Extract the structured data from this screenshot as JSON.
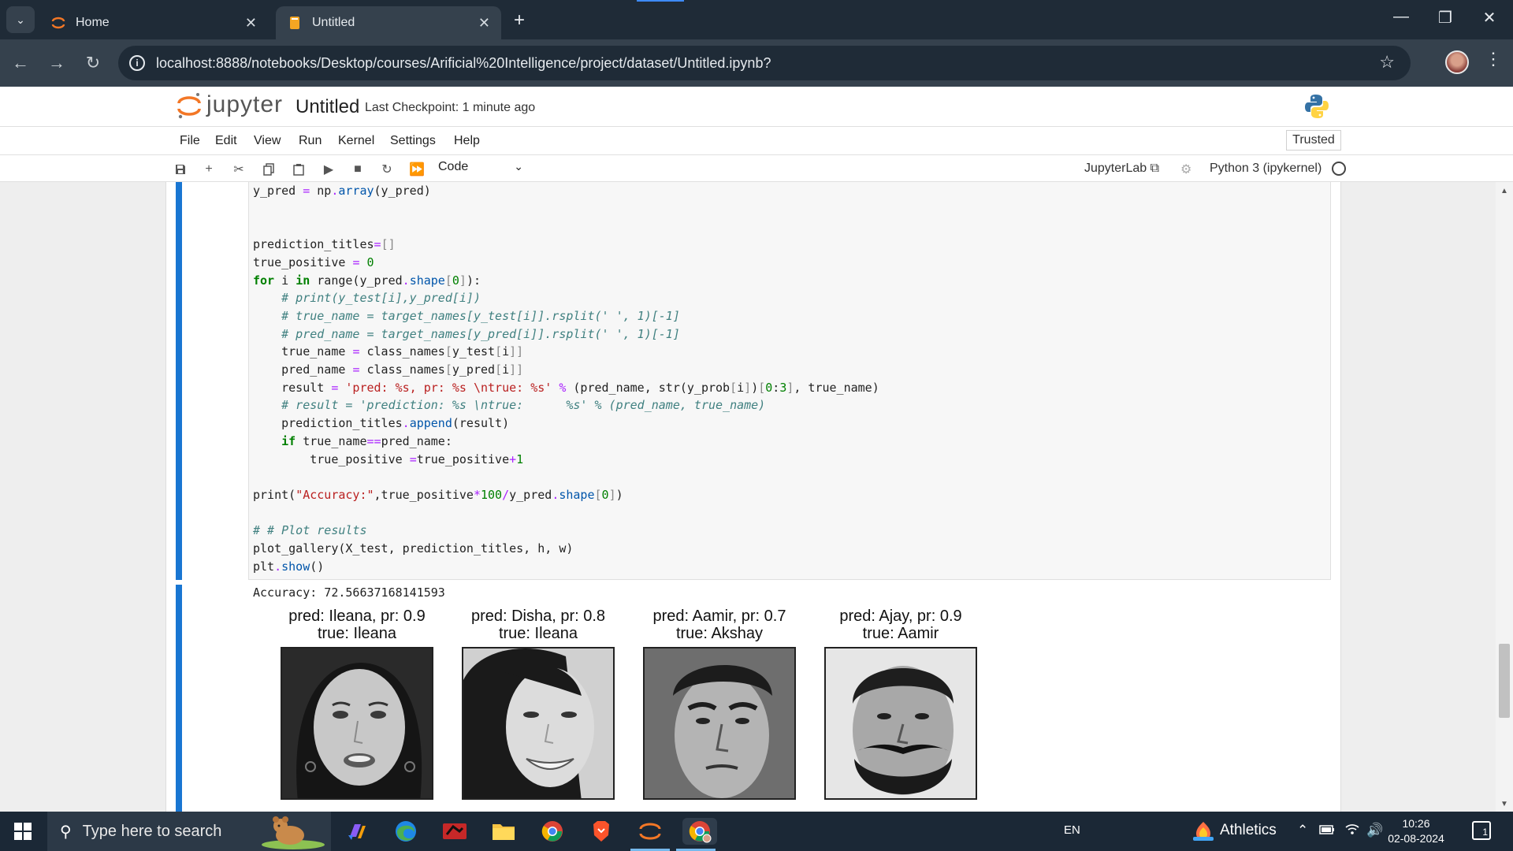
{
  "browser": {
    "tabs": [
      {
        "title": "Home",
        "active": false
      },
      {
        "title": "Untitled",
        "active": true
      }
    ],
    "url": "localhost:8888/notebooks/Desktop/courses/Arificial%20Intelligence/project/dataset/Untitled.ipynb?"
  },
  "jupyter": {
    "wordmark": "jupyter",
    "notebook_title": "Untitled",
    "checkpoint": "Last Checkpoint: 1 minute ago",
    "menu": [
      "File",
      "Edit",
      "View",
      "Run",
      "Kernel",
      "Settings",
      "Help"
    ],
    "trusted": "Trusted",
    "toolbar": {
      "cell_type": "Code",
      "jupyterlab_link": "JupyterLab",
      "kernel": "Python 3 (ipykernel)"
    }
  },
  "cell": {
    "code_lines": [
      "y_pred = np.array(y_pred)",
      "",
      "",
      "prediction_titles=[]",
      "true_positive = 0",
      "for i in range(y_pred.shape[0]):",
      "    # print(y_test[i],y_pred[i])",
      "    # true_name = target_names[y_test[i]].rsplit(' ', 1)[-1]",
      "    # pred_name = target_names[y_pred[i]].rsplit(' ', 1)[-1]",
      "    true_name = class_names[y_test[i]]",
      "    pred_name = class_names[y_pred[i]]",
      "    result = 'pred: %s, pr: %s \\ntrue: %s' % (pred_name, str(y_prob[i])[0:3], true_name)",
      "    # result = 'prediction: %s \\ntrue:      %s' % (pred_name, true_name)",
      "    prediction_titles.append(result)",
      "    if true_name==pred_name:",
      "        true_positive =true_positive+1",
      "",
      "print(\"Accuracy:\",true_positive*100/y_pred.shape[0])",
      "",
      "# # Plot results",
      "plot_gallery(X_test, prediction_titles, h, w)",
      "plt.show()"
    ],
    "output_text": "Accuracy: 72.56637168141593",
    "gallery": [
      {
        "line1": "pred: Ileana, pr: 0.9",
        "line2": "true: Ileana"
      },
      {
        "line1": "pred: Disha, pr: 0.8",
        "line2": "true: Ileana"
      },
      {
        "line1": "pred: Aamir, pr: 0.7",
        "line2": "true: Akshay"
      },
      {
        "line1": "pred: Ajay, pr: 0.9",
        "line2": "true: Aamir"
      }
    ]
  },
  "taskbar": {
    "search_placeholder": "Type here to search",
    "language": "EN",
    "weather": "Athletics",
    "time": "10:26",
    "date": "02-08-2024",
    "notification_count": "1"
  }
}
